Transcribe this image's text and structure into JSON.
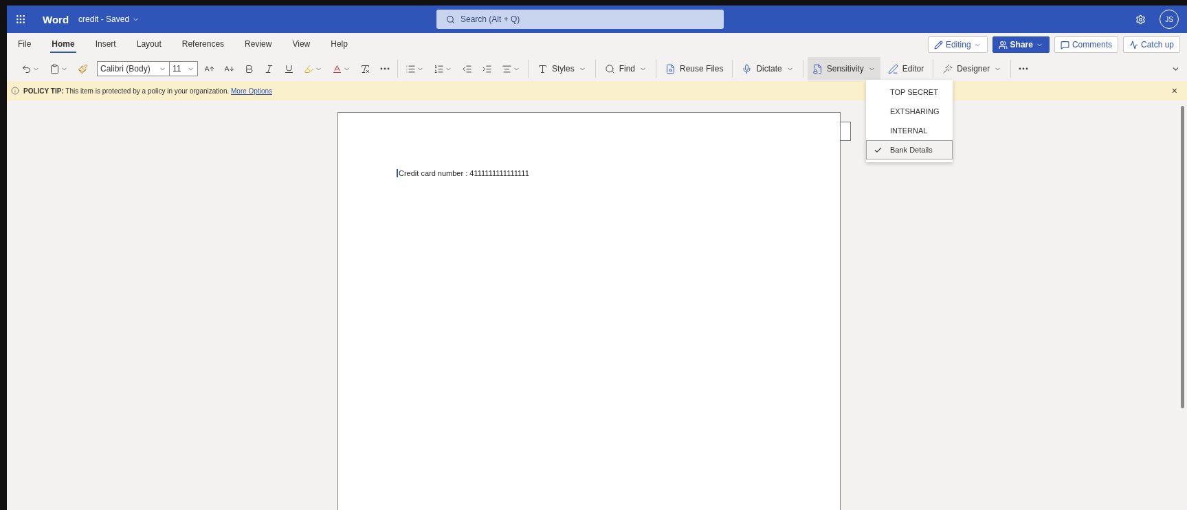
{
  "top_bar": {
    "app_name": "Word",
    "document": "credit",
    "status": "- Saved",
    "search_placeholder": "Search (Alt + Q)",
    "initials": "JS"
  },
  "menu_tabs": [
    {
      "label": "File",
      "selected": false
    },
    {
      "label": "Home",
      "selected": true
    },
    {
      "label": "Insert",
      "selected": false
    },
    {
      "label": "Layout",
      "selected": false
    },
    {
      "label": "References",
      "selected": false
    },
    {
      "label": "Review",
      "selected": false
    },
    {
      "label": "View",
      "selected": false
    },
    {
      "label": "Help",
      "selected": false
    }
  ],
  "actions": [
    {
      "kind": "mode",
      "label": "Editing"
    },
    {
      "kind": "primary",
      "label": "Share"
    },
    {
      "kind": "comments",
      "label": "Comments"
    },
    {
      "kind": "catchup",
      "label": "Catch up"
    }
  ],
  "ribbon": [
    {
      "kind": "undo"
    },
    {
      "kind": "clipboard"
    },
    {
      "kind": "painter"
    },
    {
      "kind": "font",
      "value": "Calibri (Body)"
    },
    {
      "kind": "size",
      "value": "11"
    },
    {
      "kind": "grow"
    },
    {
      "kind": "shrink"
    },
    {
      "kind": "bold"
    },
    {
      "kind": "italic"
    },
    {
      "kind": "underline"
    },
    {
      "kind": "highlight"
    },
    {
      "kind": "fontcolor"
    },
    {
      "kind": "clear"
    },
    {
      "kind": "more"
    },
    {
      "kind": "separator"
    },
    {
      "kind": "bullets"
    },
    {
      "kind": "numbering"
    },
    {
      "kind": "outdent"
    },
    {
      "kind": "indent"
    },
    {
      "kind": "align"
    },
    {
      "kind": "separator"
    },
    {
      "kind": "styles",
      "label": "Styles",
      "expanded": false
    },
    {
      "kind": "separator"
    },
    {
      "kind": "find",
      "label": "Find",
      "expanded": false
    },
    {
      "kind": "separator"
    },
    {
      "kind": "reuse",
      "label": "Reuse Files",
      "expanded": false
    },
    {
      "kind": "separator"
    },
    {
      "kind": "dictate",
      "label": "Dictate",
      "expanded": false
    },
    {
      "kind": "separator"
    },
    {
      "kind": "sensitivity",
      "label": "Sensitivity",
      "expanded": true
    },
    {
      "kind": "editor",
      "label": "Editor",
      "expanded": false
    },
    {
      "kind": "separator"
    },
    {
      "kind": "designer",
      "label": "Designer",
      "expanded": false
    },
    {
      "kind": "separator"
    },
    {
      "kind": "more"
    }
  ],
  "policy_tip": {
    "label": "POLICY TIP:",
    "text": "This item is protected by a policy in your organization.",
    "link": "More Options",
    "close": "×"
  },
  "sensitivity_menu": [
    {
      "label": "TOP SECRET",
      "selected": false
    },
    {
      "label": "EXTSHARING",
      "selected": false
    },
    {
      "label": "INTERNAL",
      "selected": false
    },
    {
      "label": "Bank Details",
      "selected": true
    }
  ],
  "document": {
    "text": "Credit card number : 4111111111111111"
  }
}
